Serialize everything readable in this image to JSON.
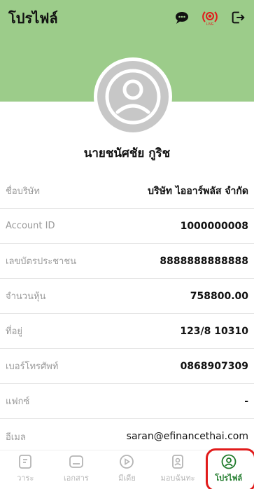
{
  "header": {
    "title": "โปรไฟล์",
    "icons": [
      "chat-icon",
      "live-icon",
      "logout-icon"
    ],
    "live_badge_text": "LIVE",
    "accent": "#9ccc8a"
  },
  "profile": {
    "name": "นายชนัศชัย กูริช"
  },
  "rows": [
    {
      "label": "ชื่อบริษัท",
      "value": "บริษัท ไออาร์พลัส จำกัด"
    },
    {
      "label": "Account ID",
      "value": "1000000008"
    },
    {
      "label": "เลขบัตรประชาชน",
      "value": "8888888888888"
    },
    {
      "label": "จำนวนหุ้น",
      "value": "758800.00"
    },
    {
      "label": "ที่อยู่",
      "value": "123/8 10310"
    },
    {
      "label": "เบอร์โทรศัพท์",
      "value": "0868907309"
    },
    {
      "label": "แฟกซ์",
      "value": "-"
    },
    {
      "label": "อีเมล",
      "value": "saran@efinancethai.com"
    }
  ],
  "nav": {
    "items": [
      {
        "label": "วาระ",
        "icon": "agenda-icon"
      },
      {
        "label": "เอกสาร",
        "icon": "document-icon"
      },
      {
        "label": "มีเดีย",
        "icon": "media-play-icon"
      },
      {
        "label": "มอบฉันทะ",
        "icon": "proxy-icon"
      },
      {
        "label": "โปรไฟล์",
        "icon": "profile-icon"
      }
    ],
    "active_color": "#1e7a2a",
    "inactive_color": "#b5b5b5",
    "highlight_color": "#e11b1b"
  }
}
